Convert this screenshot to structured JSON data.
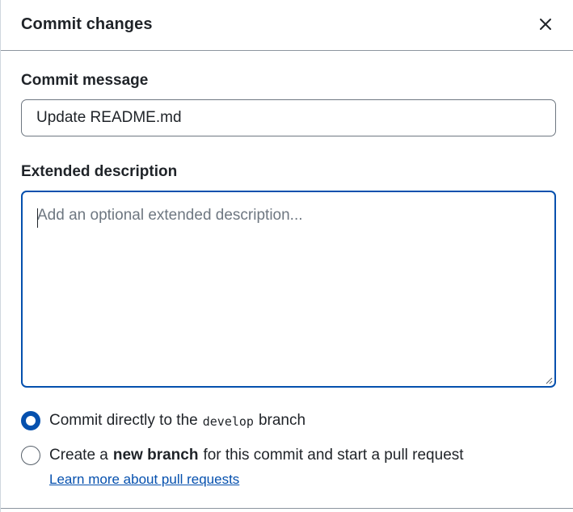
{
  "dialog": {
    "title": "Commit changes",
    "close_icon": "x-icon"
  },
  "commit_message": {
    "label": "Commit message",
    "value": "Update README.md"
  },
  "extended_description": {
    "label": "Extended description",
    "placeholder": "Add an optional extended description..."
  },
  "options": {
    "direct": {
      "prefix": "Commit directly to the",
      "branch": "develop",
      "suffix": "branch",
      "selected": true
    },
    "new_branch": {
      "prefix": "Create a",
      "bold": "new branch",
      "suffix": "for this commit and start a pull request",
      "selected": false
    },
    "learn_more_link": "Learn more about pull requests"
  },
  "colors": {
    "accent": "#0550ae",
    "border": "#6e7781",
    "text": "#1f2328",
    "placeholder": "#6e7781"
  }
}
